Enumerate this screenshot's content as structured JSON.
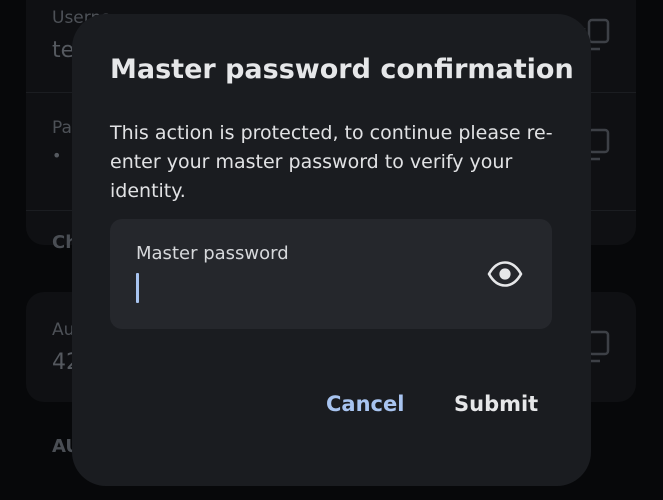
{
  "background": {
    "username_label": "Userna",
    "username_value": "te",
    "password_label": "Pa",
    "password_value": "•",
    "section_label": "Ch",
    "code_label": "Au",
    "code_value": "42",
    "bottom_section_label": "AU"
  },
  "dialog": {
    "title": "Master password confirmation",
    "message": "This action is protected, to continue please re-enter your master password to verify your identity.",
    "field": {
      "label": "Master password",
      "value": "",
      "placeholder": ""
    },
    "icons": {
      "visibility_toggle": "eye-icon",
      "copy": "copy-icon"
    },
    "actions": {
      "cancel_label": "Cancel",
      "submit_label": "Submit"
    }
  },
  "colors": {
    "accent": "#a8c4f0",
    "dialog_background": "#1a1c20",
    "field_background": "#25272c",
    "text_primary": "#e6e7e9"
  }
}
